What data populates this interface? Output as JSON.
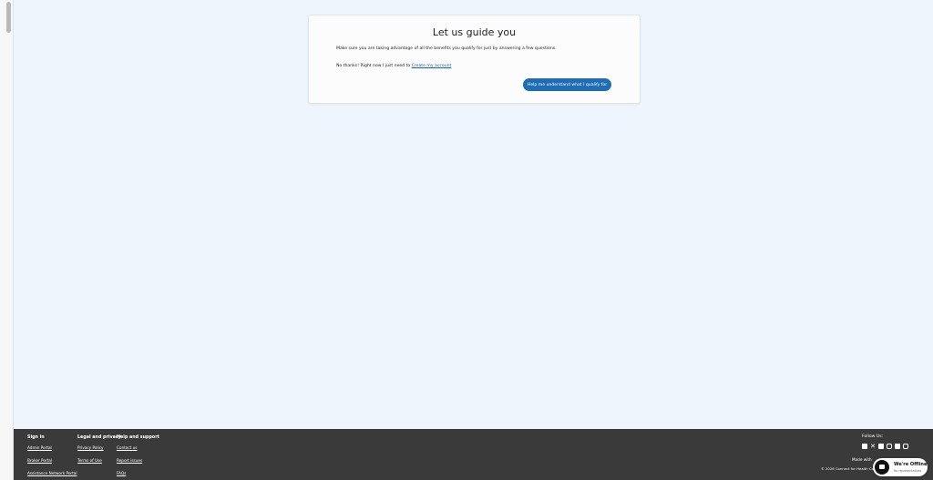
{
  "card": {
    "title": "Let us guide you",
    "intro": "Make sure you are taking advantage of all the benefits you qualify for just by answering a few questions.",
    "skip_prefix": "No thanks! Right now I just need to ",
    "skip_link": "Create my account",
    "guide_button": "Help me understand what I qualify for"
  },
  "footer": {
    "sign_in": {
      "heading": "Sign in",
      "links": [
        "Admin Portal",
        "Broker Portal",
        "Assistance Network Portal"
      ]
    },
    "legal": {
      "heading": "Legal and privacy",
      "links": [
        "Privacy Policy",
        "Terms of Use"
      ]
    },
    "help": {
      "heading": "Help and support",
      "links": [
        "Contact us",
        "Report issues",
        "FAQs"
      ]
    },
    "follow_label": "Follow Us:",
    "social_icons": [
      "facebook-icon",
      "x-icon",
      "youtube-icon",
      "instagram-icon",
      "linkedin-icon",
      "threads-icon"
    ],
    "made_with": "Made with",
    "copyright": "© 2026 Connect for Health Co"
  },
  "chat": {
    "status": "We're Offline",
    "subtext": "No representatives"
  },
  "colors": {
    "page_bg": "#eef5fd",
    "primary": "#1f6db2",
    "footer_bg": "#3a3a3a",
    "link": "#1a5fb4"
  }
}
